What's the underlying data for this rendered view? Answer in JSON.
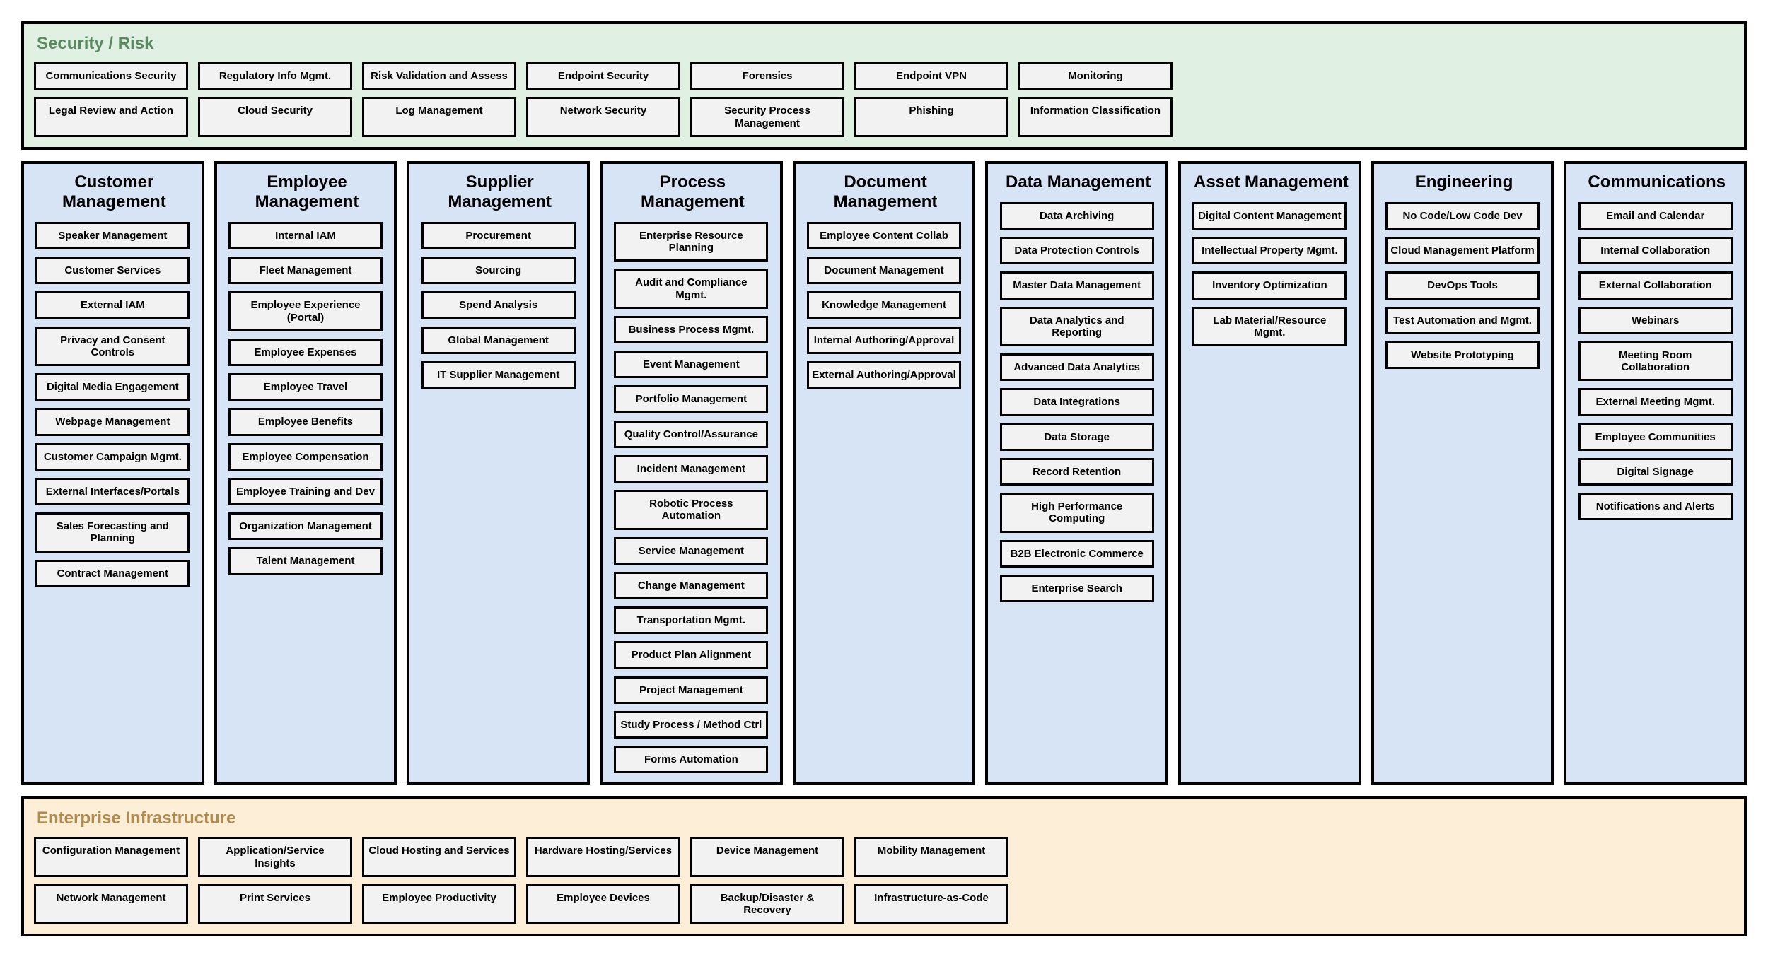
{
  "top": {
    "title": "Security / Risk",
    "rows": [
      [
        "Communications Security",
        "Regulatory Info Mgmt.",
        "Risk Validation and Assess",
        "Endpoint Security",
        "Forensics",
        "Endpoint VPN",
        "Monitoring"
      ],
      [
        "Legal Review and Action",
        "Cloud Security",
        "Log Management",
        "Network Security",
        "Security Process Management",
        "Phishing",
        "Information Classification"
      ]
    ]
  },
  "columns": [
    {
      "title": "Customer Management",
      "items": [
        "Speaker Management",
        "Customer Services",
        "External IAM",
        "Privacy and Consent Controls",
        "Digital Media Engagement",
        "Webpage Management",
        "Customer Campaign Mgmt.",
        "External Interfaces/Portals",
        "Sales Forecasting and Planning",
        "Contract Management"
      ]
    },
    {
      "title": "Employee Management",
      "items": [
        "Internal IAM",
        "Fleet Management",
        "Employee Experience (Portal)",
        "Employee Expenses",
        "Employee Travel",
        "Employee Benefits",
        "Employee Compensation",
        "Employee Training and Dev",
        "Organization Management",
        "Talent Management"
      ]
    },
    {
      "title": "Supplier Management",
      "items": [
        "Procurement",
        "Sourcing",
        "Spend Analysis",
        "Global Management",
        "IT Supplier Management"
      ]
    },
    {
      "title": "Process Management",
      "items": [
        "Enterprise Resource Planning",
        "Audit and Compliance Mgmt.",
        "Business Process Mgmt.",
        "Event Management",
        "Portfolio Management",
        "Quality Control/Assurance",
        "Incident Management",
        "Robotic Process Automation",
        "Service Management",
        "Change Management",
        "Transportation Mgmt.",
        "Product Plan Alignment",
        "Project Management",
        "Study Process / Method Ctrl",
        "Forms Automation"
      ]
    },
    {
      "title": "Document Management",
      "items": [
        "Employee Content Collab",
        "Document Management",
        "Knowledge Management",
        "Internal Authoring/Approval",
        "External Authoring/Approval"
      ]
    },
    {
      "title": "Data Management",
      "items": [
        "Data Archiving",
        "Data Protection Controls",
        "Master Data Management",
        "Data Analytics and Reporting",
        "Advanced Data Analytics",
        "Data Integrations",
        "Data Storage",
        "Record Retention",
        "High Performance Computing",
        "B2B Electronic Commerce",
        "Enterprise Search"
      ]
    },
    {
      "title": "Asset Management",
      "items": [
        "Digital Content Management",
        "Intellectual Property Mgmt.",
        "Inventory Optimization",
        "Lab Material/Resource Mgmt."
      ]
    },
    {
      "title": "Engineering",
      "items": [
        "No Code/Low Code Dev",
        "Cloud Management Platform",
        "DevOps Tools",
        "Test Automation and Mgmt.",
        "Website Prototyping"
      ]
    },
    {
      "title": "Communications",
      "items": [
        "Email and Calendar",
        "Internal Collaboration",
        "External Collaboration",
        "Webinars",
        "Meeting Room Collaboration",
        "External Meeting Mgmt.",
        "Employee Communities",
        "Digital Signage",
        "Notifications and Alerts"
      ]
    }
  ],
  "bottom": {
    "title": "Enterprise Infrastructure",
    "rows": [
      [
        "Configuration Management",
        "Application/Service Insights",
        "Cloud Hosting and Services",
        "Hardware Hosting/Services",
        "Device Management",
        "Mobility Management"
      ],
      [
        "Network Management",
        "Print Services",
        "Employee Productivity",
        "Employee Devices",
        "Backup/Disaster & Recovery",
        "Infrastructure-as-Code"
      ]
    ]
  }
}
